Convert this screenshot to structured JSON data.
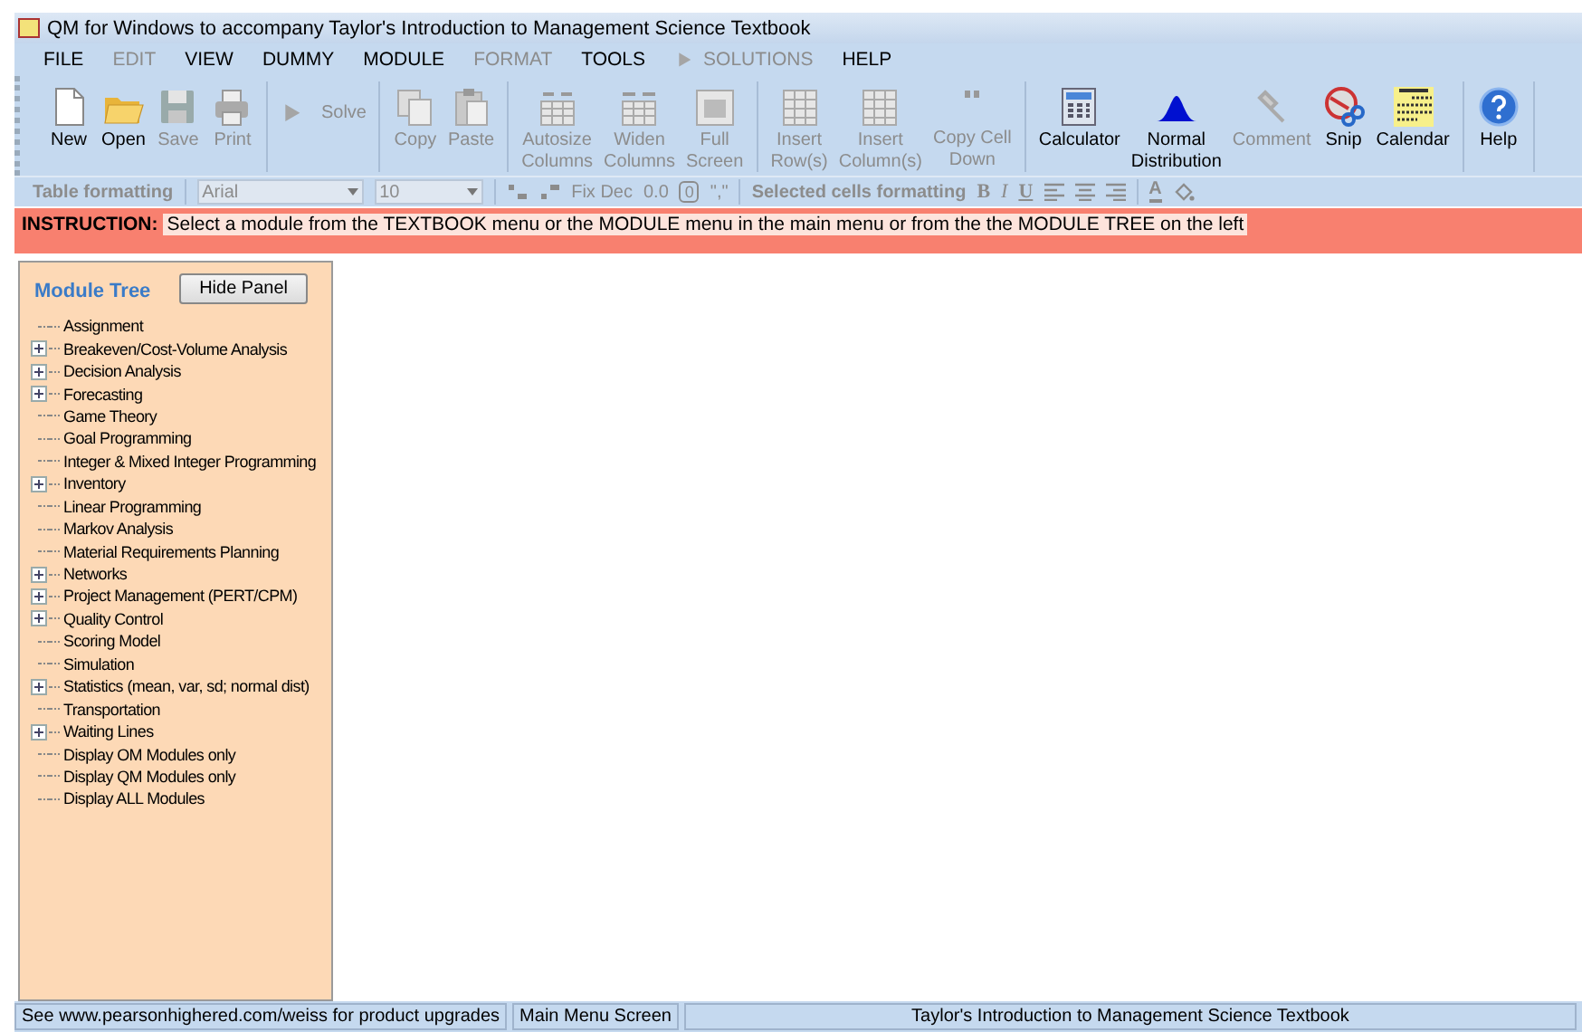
{
  "window": {
    "title": "QM for Windows to accompany Taylor's Introduction to Management Science Textbook"
  },
  "menu": [
    {
      "label": "FILE",
      "disabled": false
    },
    {
      "label": "EDIT",
      "disabled": true
    },
    {
      "label": "VIEW",
      "disabled": false
    },
    {
      "label": "DUMMY",
      "disabled": false
    },
    {
      "label": "MODULE",
      "disabled": false
    },
    {
      "label": "FORMAT",
      "disabled": true
    },
    {
      "label": "TOOLS",
      "disabled": false
    },
    {
      "label": "SOLUTIONS",
      "disabled": true,
      "kind": "solve"
    },
    {
      "label": "HELP",
      "disabled": false
    }
  ],
  "toolbar": [
    [
      {
        "label": [
          "New"
        ],
        "disabled": false,
        "kind": "large"
      },
      {
        "label": [
          "Open"
        ],
        "disabled": false,
        "kind": "large"
      },
      {
        "label": [
          "Save"
        ],
        "disabled": true,
        "kind": "large"
      },
      {
        "label": [
          "Print"
        ],
        "disabled": true,
        "kind": "large"
      }
    ],
    [
      {
        "label": [
          "Solve"
        ],
        "disabled": true,
        "kind": "inline"
      }
    ],
    [
      {
        "label": [
          "Copy"
        ],
        "disabled": true,
        "kind": "large"
      },
      {
        "label": [
          "Paste"
        ],
        "disabled": true,
        "kind": "large"
      }
    ],
    [
      {
        "label": [
          "Autosize",
          "Columns"
        ],
        "disabled": true,
        "kind": "large"
      },
      {
        "label": [
          "Widen",
          "Columns"
        ],
        "disabled": true,
        "kind": "large"
      },
      {
        "label": [
          "Full",
          "Screen"
        ],
        "disabled": true,
        "kind": "large"
      }
    ],
    [
      {
        "label": [
          "Insert",
          "Row(s)"
        ],
        "disabled": true,
        "kind": "large"
      },
      {
        "label": [
          "Insert",
          "Column(s)"
        ],
        "disabled": true,
        "kind": "large"
      },
      {
        "label": [
          "Copy Cell",
          "Down"
        ],
        "disabled": true,
        "kind": "large"
      }
    ],
    [
      {
        "label": [
          "Calculator"
        ],
        "disabled": false,
        "kind": "large"
      },
      {
        "label": [
          "Normal",
          "Distribution"
        ],
        "disabled": false,
        "kind": "large"
      },
      {
        "label": [
          "Comment"
        ],
        "disabled": true,
        "kind": "large"
      },
      {
        "label": [
          "Snip"
        ],
        "disabled": false,
        "kind": "large"
      },
      {
        "label": [
          "Calendar"
        ],
        "disabled": false,
        "kind": "large"
      }
    ],
    [
      {
        "label": [
          "Help"
        ],
        "disabled": false,
        "kind": "large"
      }
    ]
  ],
  "format_bar": {
    "label": "Table formatting",
    "font": "Arial",
    "size": "10",
    "items": [
      {
        "kind": "increase-decimal"
      },
      {
        "kind": "decrease-decimal"
      },
      {
        "kind": "text",
        "text": "Fix Dec"
      },
      {
        "kind": "text",
        "text": "0.0"
      },
      {
        "kind": "boxed",
        "text": "0"
      },
      {
        "kind": "text",
        "text": "\",\""
      },
      {
        "kind": "label",
        "text": "Selected cells formatting"
      },
      {
        "kind": "bold",
        "text": "B"
      },
      {
        "kind": "italic",
        "text": "I"
      },
      {
        "kind": "underline",
        "text": "U"
      },
      {
        "kind": "align-left"
      },
      {
        "kind": "align-center"
      },
      {
        "kind": "align-right"
      },
      {
        "kind": "font-color",
        "text": "A"
      },
      {
        "kind": "fill-color"
      }
    ]
  },
  "instruction": {
    "label": "INSTRUCTION:",
    "text": "Select a module from the TEXTBOOK menu or the MODULE menu in the main menu or from the the MODULE TREE on the left"
  },
  "module_tree": {
    "title": "Module Tree",
    "hide_button": "Hide Panel",
    "items": [
      {
        "label": "Assignment",
        "expandable": false
      },
      {
        "label": "Breakeven/Cost-Volume Analysis",
        "expandable": true
      },
      {
        "label": "Decision Analysis",
        "expandable": true
      },
      {
        "label": "Forecasting",
        "expandable": true
      },
      {
        "label": "Game Theory",
        "expandable": false
      },
      {
        "label": "Goal Programming",
        "expandable": false
      },
      {
        "label": "Integer & Mixed Integer Programming",
        "expandable": false
      },
      {
        "label": "Inventory",
        "expandable": true
      },
      {
        "label": "Linear Programming",
        "expandable": false
      },
      {
        "label": "Markov Analysis",
        "expandable": false
      },
      {
        "label": "Material Requirements Planning",
        "expandable": false
      },
      {
        "label": "Networks",
        "expandable": true
      },
      {
        "label": "Project Management (PERT/CPM)",
        "expandable": true
      },
      {
        "label": "Quality Control",
        "expandable": true
      },
      {
        "label": "Scoring Model",
        "expandable": false
      },
      {
        "label": "Simulation",
        "expandable": false
      },
      {
        "label": "Statistics (mean, var, sd; normal dist)",
        "expandable": true
      },
      {
        "label": "Transportation",
        "expandable": false
      },
      {
        "label": "Waiting Lines",
        "expandable": true
      },
      {
        "label": "Display OM Modules only",
        "expandable": false
      },
      {
        "label": "Display QM Modules only",
        "expandable": false
      },
      {
        "label": "Display ALL Modules",
        "expandable": false
      }
    ]
  },
  "status_bar": [
    "See www.pearsonhighered.com/weiss for product upgrades",
    "Main Menu Screen",
    "Taylor's Introduction to Management Science Textbook"
  ]
}
